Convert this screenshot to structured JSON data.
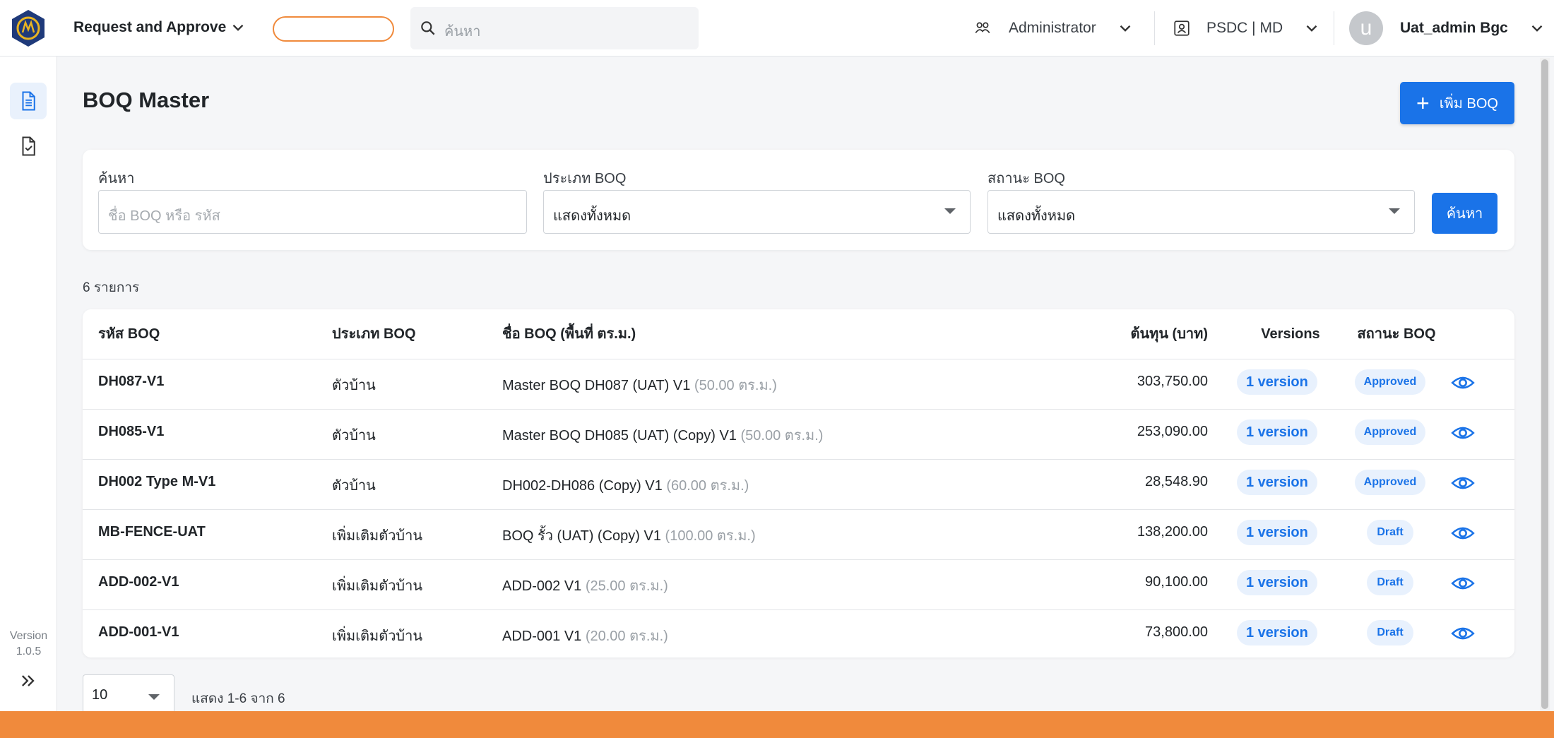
{
  "header": {
    "app_title": "Request and Approve",
    "search_placeholder": "ค้นหา",
    "role": "Administrator",
    "org": "PSDC | MD",
    "avatar_letter": "u",
    "user_name": "Uat_admin Bgc"
  },
  "sidebar": {
    "items": [
      {
        "name": "boq-document-icon",
        "active": true
      },
      {
        "name": "approval-document-icon",
        "active": false
      }
    ],
    "version_label": "Version",
    "version_number": "1.0.5"
  },
  "page": {
    "title": "BOQ Master",
    "add_button_label": "เพิ่ม BOQ"
  },
  "filters": {
    "search_label": "ค้นหา",
    "search_placeholder": "ชื่อ BOQ หรือ รหัส",
    "type_label": "ประเภท BOQ",
    "type_value": "แสดงทั้งหมด",
    "status_label": "สถานะ BOQ",
    "status_value": "แสดงทั้งหมด",
    "search_button": "ค้นหา"
  },
  "results": {
    "count_text": "6 รายการ"
  },
  "table": {
    "headers": {
      "code": "รหัส BOQ",
      "type": "ประเภท BOQ",
      "name": "ชื่อ BOQ (พื้นที่ ตร.ม.)",
      "cost": "ต้นทุน (บาท)",
      "versions": "Versions",
      "status": "สถานะ BOQ"
    },
    "rows": [
      {
        "code": "DH087-V1",
        "type": "ตัวบ้าน",
        "name": "Master BOQ DH087 (UAT) V1",
        "area": "(50.00 ตร.ม.)",
        "cost": "303,750.00",
        "versions": "1 version",
        "status": "Approved"
      },
      {
        "code": "DH085-V1",
        "type": "ตัวบ้าน",
        "name": "Master BOQ DH085 (UAT) (Copy) V1",
        "area": "(50.00 ตร.ม.)",
        "cost": "253,090.00",
        "versions": "1 version",
        "status": "Approved"
      },
      {
        "code": "DH002 Type M-V1",
        "type": "ตัวบ้าน",
        "name": "DH002-DH086 (Copy) V1",
        "area": "(60.00 ตร.ม.)",
        "cost": "28,548.90",
        "versions": "1 version",
        "status": "Approved"
      },
      {
        "code": "MB-FENCE-UAT",
        "type": "เพิ่มเติมตัวบ้าน",
        "name": "BOQ รั้ว (UAT) (Copy) V1",
        "area": "(100.00 ตร.ม.)",
        "cost": "138,200.00",
        "versions": "1 version",
        "status": "Draft"
      },
      {
        "code": "ADD-002-V1",
        "type": "เพิ่มเติมตัวบ้าน",
        "name": "ADD-002 V1",
        "area": "(25.00 ตร.ม.)",
        "cost": "90,100.00",
        "versions": "1 version",
        "status": "Draft"
      },
      {
        "code": "ADD-001-V1",
        "type": "เพิ่มเติมตัวบ้าน",
        "name": "ADD-001 V1",
        "area": "(20.00 ตร.ม.)",
        "cost": "73,800.00",
        "versions": "1 version",
        "status": "Draft"
      }
    ]
  },
  "pagination": {
    "page_size": "10",
    "info": "แสดง 1-6 จาก 6"
  },
  "colors": {
    "primary": "#1a73e8",
    "accent_orange": "#f08a3c",
    "logo_navy": "#1f3a7a",
    "logo_gold": "#e8b321"
  }
}
